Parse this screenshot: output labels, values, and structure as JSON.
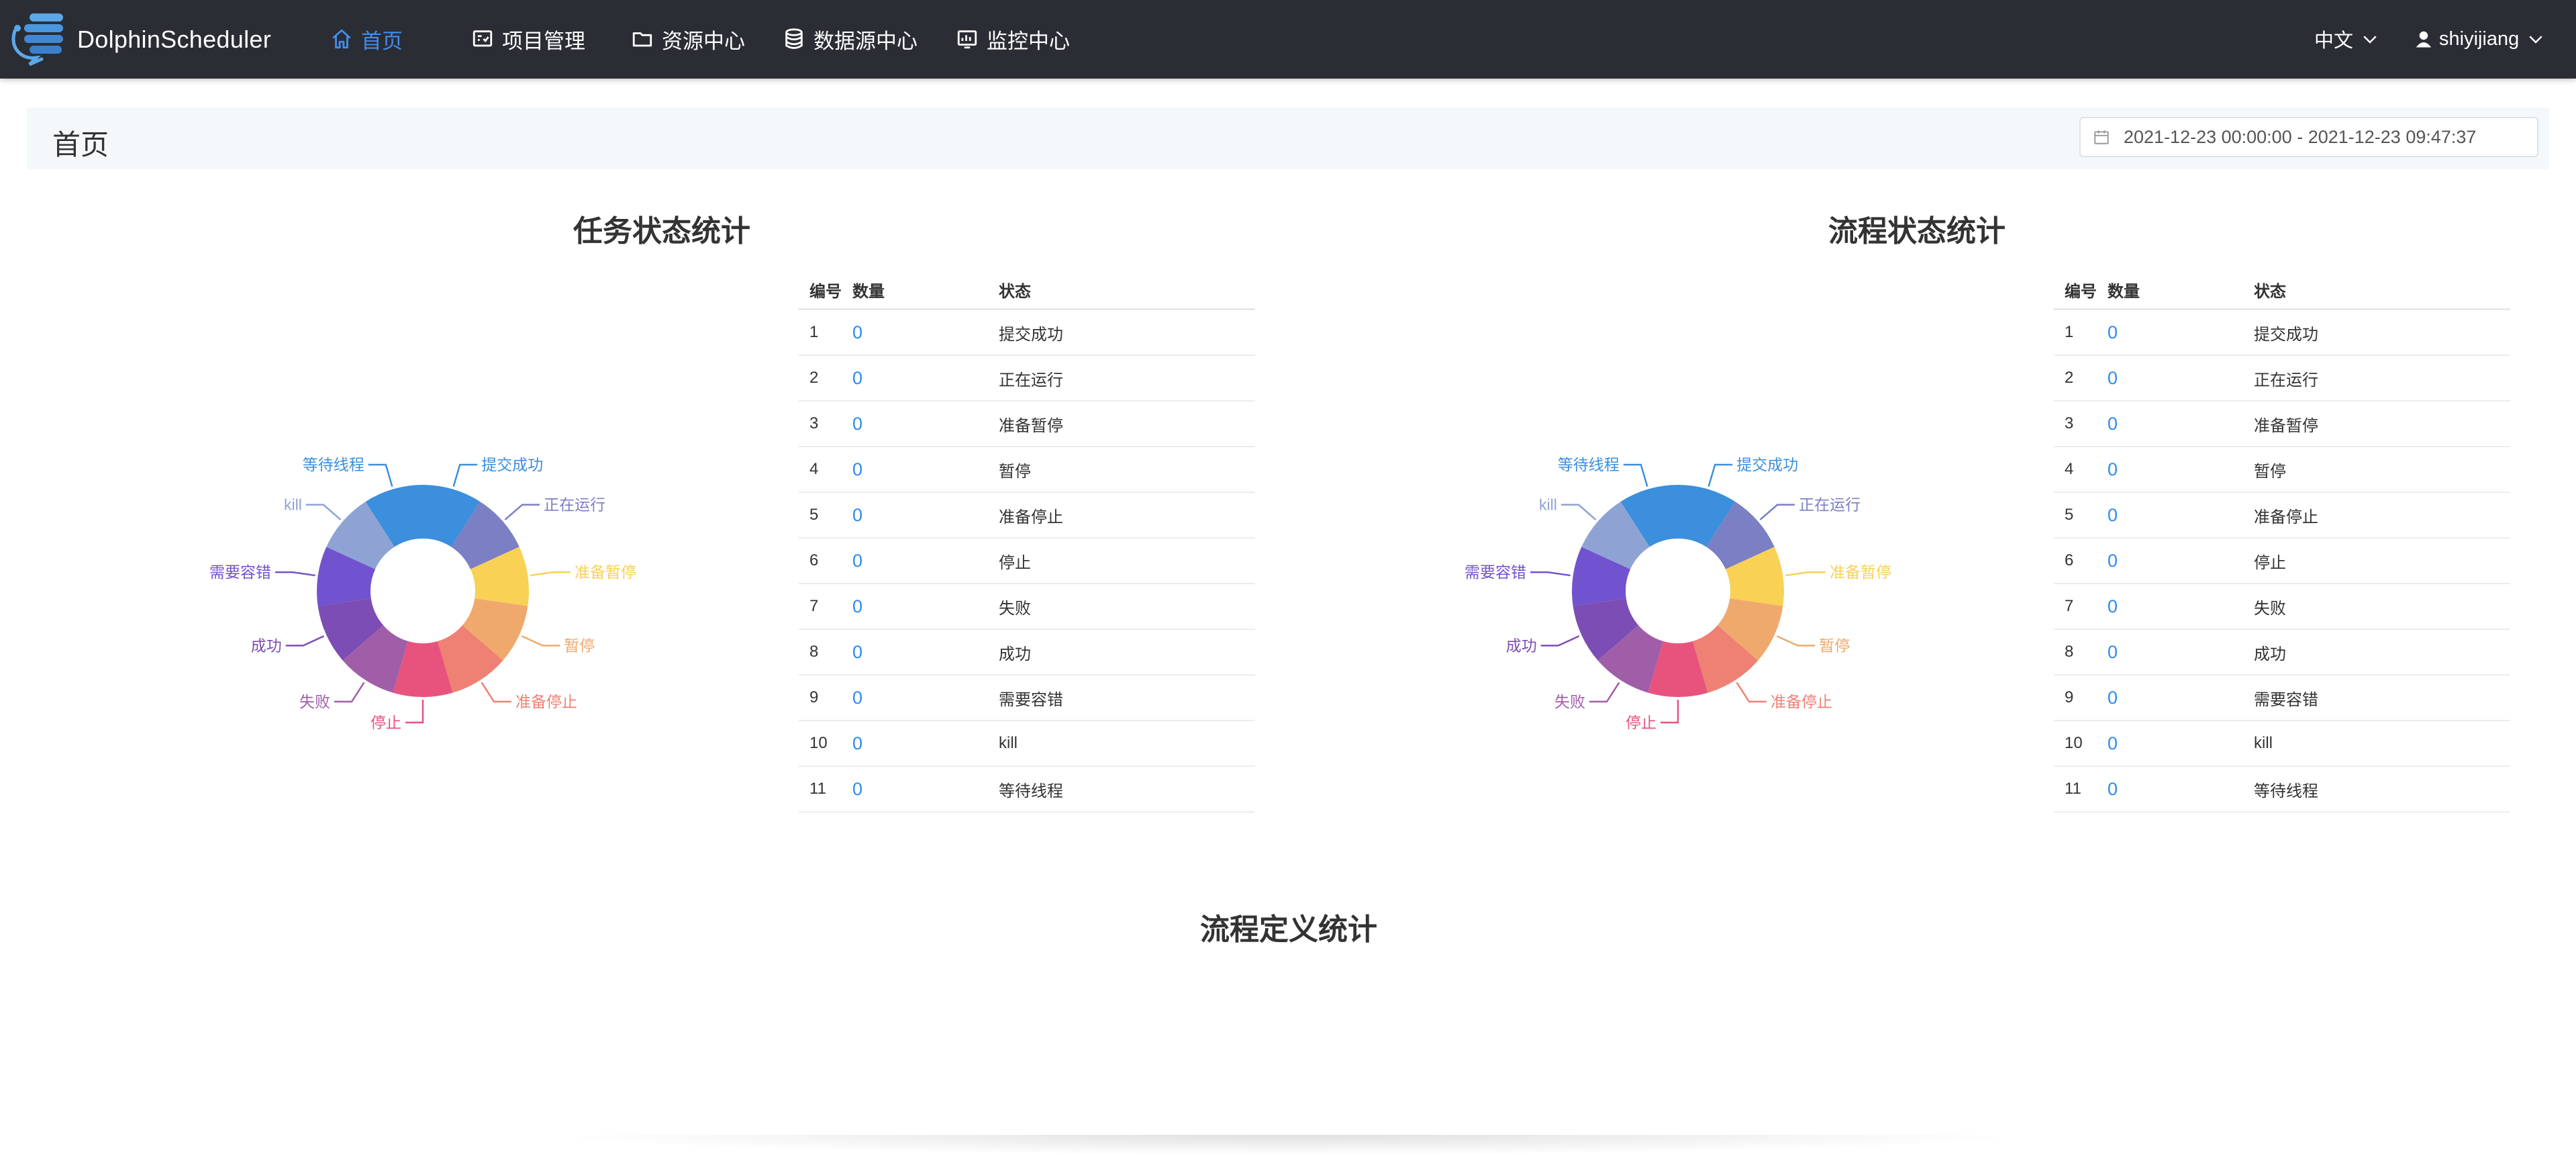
{
  "app": {
    "brand": "DolphinScheduler"
  },
  "nav": {
    "items": [
      {
        "label": "首页",
        "icon": "home-icon",
        "active": true
      },
      {
        "label": "项目管理",
        "icon": "project-icon",
        "active": false
      },
      {
        "label": "资源中心",
        "icon": "folder-icon",
        "active": false
      },
      {
        "label": "数据源中心",
        "icon": "database-icon",
        "active": false
      },
      {
        "label": "监控中心",
        "icon": "monitor-icon",
        "active": false
      }
    ],
    "language": "中文",
    "user": "shiyijiang"
  },
  "page": {
    "title": "首页",
    "date_range": "2021-12-23 00:00:00 - 2021-12-23 09:47:37"
  },
  "colors": {
    "navbar_bg": "#2b2d34",
    "active_nav": "#3f8ef0",
    "count_link": "#2d8cf0"
  },
  "task_stats": {
    "title": "任务状态统计",
    "table": {
      "headers": {
        "no": "编号",
        "count": "数量",
        "status": "状态"
      },
      "rows": [
        {
          "no": "1",
          "count": "0",
          "status": "提交成功"
        },
        {
          "no": "2",
          "count": "0",
          "status": "正在运行"
        },
        {
          "no": "3",
          "count": "0",
          "status": "准备暂停"
        },
        {
          "no": "4",
          "count": "0",
          "status": "暂停"
        },
        {
          "no": "5",
          "count": "0",
          "status": "准备停止"
        },
        {
          "no": "6",
          "count": "0",
          "status": "停止"
        },
        {
          "no": "7",
          "count": "0",
          "status": "失败"
        },
        {
          "no": "8",
          "count": "0",
          "status": "成功"
        },
        {
          "no": "9",
          "count": "0",
          "status": "需要容错"
        },
        {
          "no": "10",
          "count": "0",
          "status": "kill"
        },
        {
          "no": "11",
          "count": "0",
          "status": "等待线程"
        }
      ]
    }
  },
  "process_stats": {
    "title": "流程状态统计",
    "table": {
      "headers": {
        "no": "编号",
        "count": "数量",
        "status": "状态"
      },
      "rows": [
        {
          "no": "1",
          "count": "0",
          "status": "提交成功"
        },
        {
          "no": "2",
          "count": "0",
          "status": "正在运行"
        },
        {
          "no": "3",
          "count": "0",
          "status": "准备暂停"
        },
        {
          "no": "4",
          "count": "0",
          "status": "暂停"
        },
        {
          "no": "5",
          "count": "0",
          "status": "准备停止"
        },
        {
          "no": "6",
          "count": "0",
          "status": "停止"
        },
        {
          "no": "7",
          "count": "0",
          "status": "失败"
        },
        {
          "no": "8",
          "count": "0",
          "status": "成功"
        },
        {
          "no": "9",
          "count": "0",
          "status": "需要容错"
        },
        {
          "no": "10",
          "count": "0",
          "status": "kill"
        },
        {
          "no": "11",
          "count": "0",
          "status": "等待线程"
        }
      ]
    }
  },
  "definition_stats": {
    "title": "流程定义统计"
  },
  "chart_data": [
    {
      "type": "pie",
      "title": "任务状态统计",
      "categories": [
        "提交成功",
        "正在运行",
        "准备暂停",
        "暂停",
        "准备停止",
        "停止",
        "失败",
        "成功",
        "需要容错",
        "kill",
        "等待线程"
      ],
      "values": [
        0,
        0,
        0,
        0,
        0,
        0,
        0,
        0,
        0,
        0,
        0
      ],
      "colors": [
        "#3b8fdc",
        "#7b7fc4",
        "#f8d155",
        "#f0a96c",
        "#ef8074",
        "#e8537d",
        "#a15ea8",
        "#7c4db4",
        "#7152cf",
        "#8ea3d4",
        "#3b8fdc"
      ],
      "donut": true
    },
    {
      "type": "pie",
      "title": "流程状态统计",
      "categories": [
        "提交成功",
        "正在运行",
        "准备暂停",
        "暂停",
        "准备停止",
        "停止",
        "失败",
        "成功",
        "需要容错",
        "kill",
        "等待线程"
      ],
      "values": [
        0,
        0,
        0,
        0,
        0,
        0,
        0,
        0,
        0,
        0,
        0
      ],
      "colors": [
        "#3b8fdc",
        "#7b7fc4",
        "#f8d155",
        "#f0a96c",
        "#ef8074",
        "#e8537d",
        "#a15ea8",
        "#7c4db4",
        "#7152cf",
        "#8ea3d4",
        "#3b8fdc"
      ],
      "donut": true
    }
  ]
}
